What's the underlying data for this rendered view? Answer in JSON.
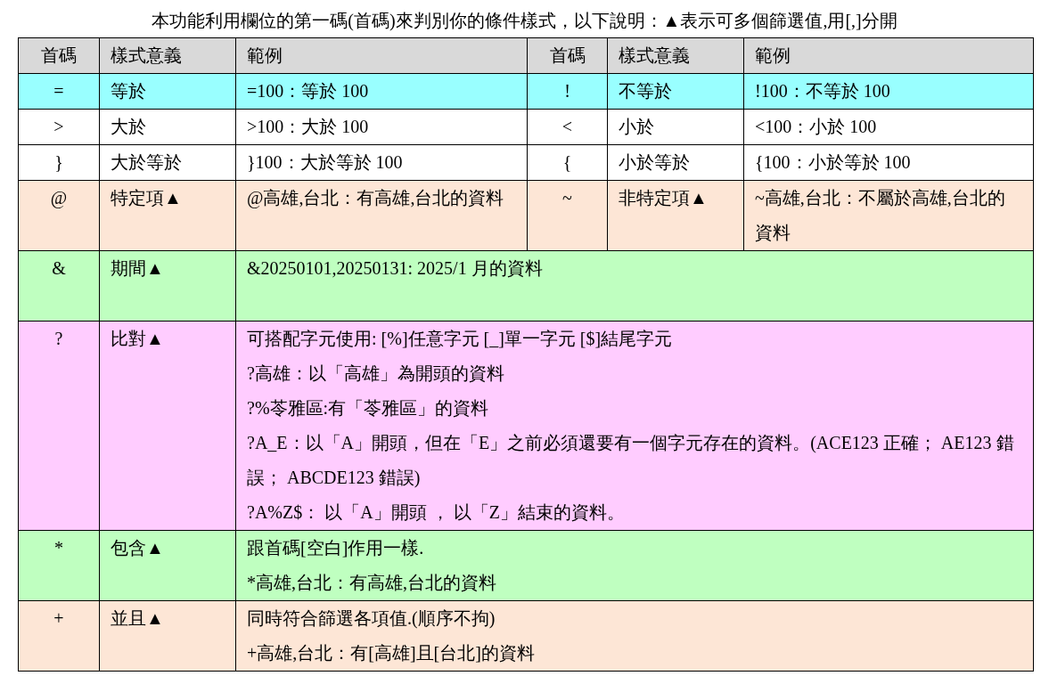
{
  "title": "本功能利用欄位的第一碼(首碼)來判別你的條件樣式，以下說明：▲表示可多個篩選值,用[,]分開",
  "columns": [
    "首碼",
    "樣式意義",
    "範例",
    "首碼",
    "樣式意義",
    "範例"
  ],
  "rows": [
    {
      "kind": "pair",
      "color": "#99ffff",
      "left": {
        "code": "=",
        "meaning": "等於",
        "example": [
          "=100：等於 100"
        ]
      },
      "right": {
        "code": "!",
        "meaning": "不等於",
        "example": [
          "!100：不等於 100"
        ]
      }
    },
    {
      "kind": "pair",
      "color": "#ffffff",
      "left": {
        "code": ">",
        "meaning": "大於",
        "example": [
          ">100：大於 100"
        ]
      },
      "right": {
        "code": "<",
        "meaning": "小於",
        "example": [
          "<100：小於 100"
        ]
      }
    },
    {
      "kind": "pair",
      "color": "#ffffff",
      "left": {
        "code": "}",
        "meaning": "大於等於",
        "example": [
          "}100：大於等於 100"
        ]
      },
      "right": {
        "code": "{",
        "meaning": "小於等於",
        "example": [
          "{100：小於等於 100"
        ]
      }
    },
    {
      "kind": "pair",
      "color": "#fde6d6",
      "left": {
        "code": "@",
        "meaning": "特定項▲",
        "example": [
          "@高雄,台北：有高雄,台北的資料"
        ]
      },
      "right": {
        "code": "~",
        "meaning": "非特定項▲",
        "example": [
          "~高雄,台北：不屬於高雄,台北的資料"
        ]
      }
    },
    {
      "kind": "span",
      "color": "#bfffc0",
      "left": {
        "code": "&",
        "meaning": "期間▲",
        "example": [
          "&20250101,20250131: 2025/1 月的資料"
        ]
      }
    },
    {
      "kind": "span",
      "color": "#ffccff",
      "left": {
        "code": "?",
        "meaning": "比對▲",
        "example": [
          "可搭配字元使用:  [%]任意字元  [_]單一字元  [$]結尾字元",
          "?高雄：以「高雄」為開頭的資料",
          "?%苓雅區:有「苓雅區」的資料",
          "?A_E：以「A」開頭，但在「E」之前必須還要有一個字元存在的資料。(ACE123 正確； AE123 錯誤； ABCDE123 錯誤)",
          "?A%Z$： 以「A」開頭 ， 以「Z」結束的資料。"
        ]
      }
    },
    {
      "kind": "span",
      "color": "#bfffc0",
      "left": {
        "code": "*",
        "meaning": "包含▲",
        "example": [
          "跟首碼[空白]作用一樣.",
          "*高雄,台北：有高雄,台北的資料"
        ]
      }
    },
    {
      "kind": "span",
      "color": "#fde6d6",
      "left": {
        "code": "+",
        "meaning": "並且▲",
        "example": [
          "同時符合篩選各項值.(順序不拘)",
          "+高雄,台北：有[高雄]且[台北]的資料"
        ]
      }
    }
  ]
}
